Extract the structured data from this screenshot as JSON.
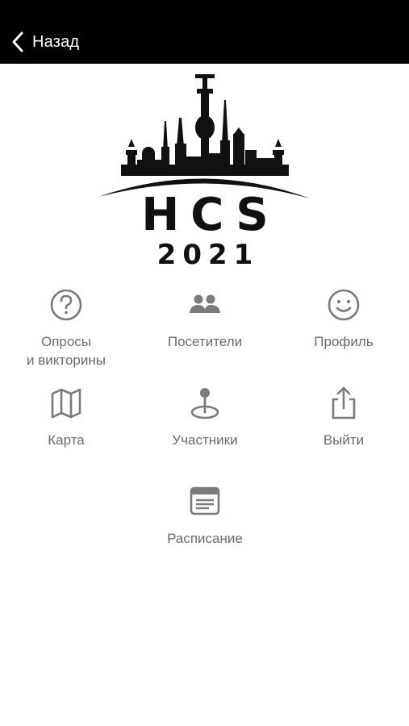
{
  "nav": {
    "back_label": "Назад"
  },
  "logo": {
    "title": "HCS",
    "year": "2021"
  },
  "menu": [
    {
      "label": "Опросы\nи викторины",
      "icon": "question-circle-icon"
    },
    {
      "label": "Посетители",
      "icon": "people-icon"
    },
    {
      "label": "Профиль",
      "icon": "smiley-face-icon"
    },
    {
      "label": "Карта",
      "icon": "map-icon"
    },
    {
      "label": "Участники",
      "icon": "location-pin-icon"
    },
    {
      "label": "Выйти",
      "icon": "share-exit-icon"
    },
    {
      "label": "Расписание",
      "icon": "schedule-card-icon"
    }
  ],
  "colors": {
    "header": "#000000",
    "icon": "#7a7a7a",
    "label": "#6b6b6b"
  }
}
